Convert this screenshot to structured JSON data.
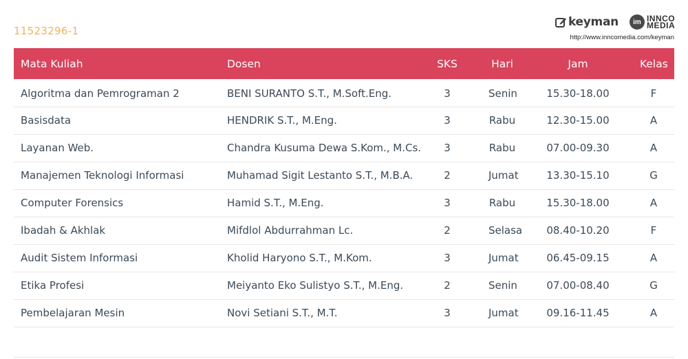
{
  "student_id": "11523296-1",
  "brand": {
    "keyman_label": "keyman",
    "inno_badge": "im",
    "inno_line1": "INNCO",
    "inno_line2": "MEDIA",
    "url": "http://www.inncomedia.com/keyman",
    "icon": "pencil-square-icon"
  },
  "colors": {
    "header_bg": "#d9435c",
    "student_id": "#f3b25b",
    "cell_text": "#3a4a57"
  },
  "table": {
    "headers": [
      "Mata Kuliah",
      "Dosen",
      "SKS",
      "Hari",
      "Jam",
      "Kelas"
    ],
    "rows": [
      [
        "Algoritma dan Pemrograman 2",
        "BENI SURANTO S.T., M.Soft.Eng.",
        "3",
        "Senin",
        "15.30-18.00",
        "F"
      ],
      [
        "Basisdata",
        "HENDRIK S.T., M.Eng.",
        "3",
        "Rabu",
        "12.30-15.00",
        "A"
      ],
      [
        "Layanan Web.",
        "Chandra Kusuma Dewa S.Kom., M.Cs.",
        "3",
        "Rabu",
        "07.00-09.30",
        "A"
      ],
      [
        "Manajemen Teknologi Informasi",
        "Muhamad Sigit Lestanto S.T., M.B.A.",
        "2",
        "Jumat",
        "13.30-15.10",
        "G"
      ],
      [
        "Computer Forensics",
        "Hamid S.T., M.Eng.",
        "3",
        "Rabu",
        "15.30-18.00",
        "A"
      ],
      [
        "Ibadah & Akhlak",
        "Mifdlol Abdurrahman Lc.",
        "2",
        "Selasa",
        "08.40-10.20",
        "F"
      ],
      [
        "Audit Sistem Informasi",
        "Kholid Haryono S.T., M.Kom.",
        "3",
        "Jumat",
        "06.45-09.15",
        "A"
      ],
      [
        "Etika Profesi",
        "Meiyanto Eko Sulistyo S.T., M.Eng.",
        "2",
        "Senin",
        "07.00-08.40",
        "G"
      ],
      [
        "Pembelajaran Mesin",
        "Novi Setiani S.T., M.T.",
        "3",
        "Jumat",
        "09.16-11.45",
        "A"
      ]
    ]
  }
}
